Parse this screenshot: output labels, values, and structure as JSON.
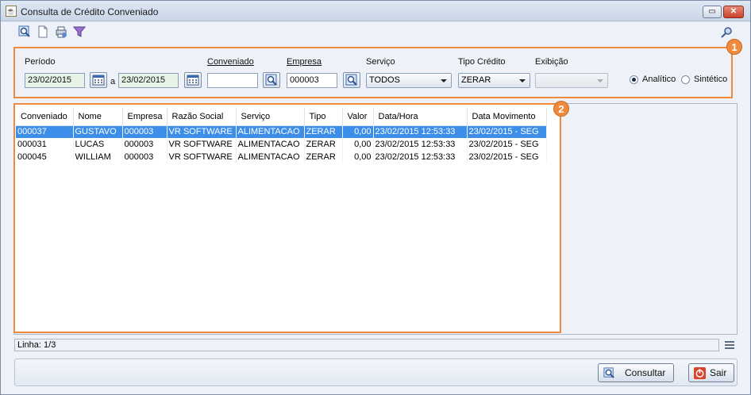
{
  "window": {
    "title": "Consulta de Crédito Conveniado"
  },
  "badges": {
    "panel1": "1",
    "panel2": "2"
  },
  "filters": {
    "periodo_label": "Período",
    "date_from": "23/02/2015",
    "date_sep": "a",
    "date_to": "23/02/2015",
    "conveniado_label": "Conveniado",
    "conveniado_value": "",
    "empresa_label": "Empresa",
    "empresa_value": "000003",
    "servico_label": "Serviço",
    "servico_value": "TODOS",
    "tipo_label": "Tipo Crédito",
    "tipo_value": "ZERAR",
    "exibicao_label": "Exibição",
    "exibicao_value": "",
    "radio_analitico": "Analítico",
    "radio_sintetico": "Sintético",
    "selected_mode": "Analítico"
  },
  "table": {
    "columns": [
      "Conveniado",
      "Nome",
      "Empresa",
      "Razão Social",
      "Serviço",
      "Tipo",
      "Valor",
      "Data/Hora",
      "Data Movimento"
    ],
    "rows": [
      [
        "000037",
        "GUSTAVO",
        "000003",
        "VR SOFTWARE",
        "ALIMENTACAO",
        "ZERAR",
        "0,00",
        "23/02/2015 12:53:33",
        "23/02/2015 - SEG"
      ],
      [
        "000031",
        "LUCAS",
        "000003",
        "VR SOFTWARE",
        "ALIMENTACAO",
        "ZERAR",
        "0,00",
        "23/02/2015 12:53:33",
        "23/02/2015 - SEG"
      ],
      [
        "000045",
        "WILLIAM",
        "000003",
        "VR SOFTWARE",
        "ALIMENTACAO",
        "ZERAR",
        "0,00",
        "23/02/2015 12:53:33",
        "23/02/2015 - SEG"
      ]
    ],
    "selected_row": 0
  },
  "status": {
    "linha": "Linha: 1/3"
  },
  "buttons": {
    "consultar": "Consultar",
    "sair": "Sair"
  },
  "colors": {
    "accent_orange": "#f08a3c",
    "selection_blue": "#3d8ee8"
  },
  "icons": [
    "search-icon",
    "new-document-icon",
    "print-icon",
    "filter-icon",
    "key-icon",
    "calendar-icon",
    "lookup-icon",
    "menu-icon"
  ]
}
